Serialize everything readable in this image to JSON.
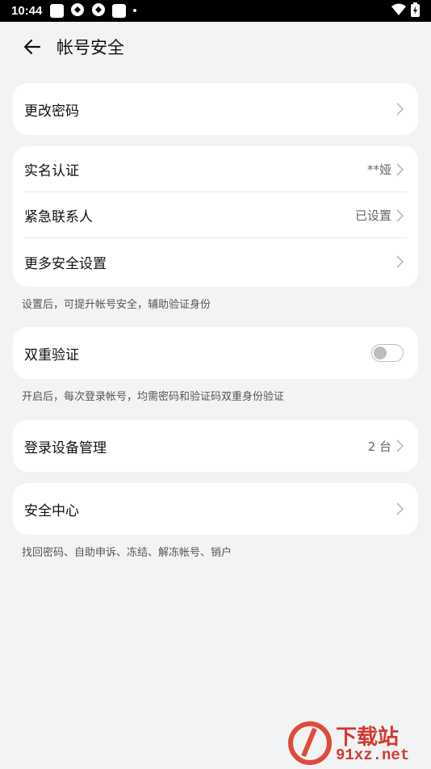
{
  "status_bar": {
    "time": "10:44",
    "dot": "•"
  },
  "header": {
    "title": "帐号安全"
  },
  "groups": {
    "password": {
      "label": "更改密码"
    },
    "identity": {
      "items": [
        {
          "label": "实名认证",
          "value": "**娅"
        },
        {
          "label": "紧急联系人",
          "value": "已设置"
        },
        {
          "label": "更多安全设置",
          "value": ""
        }
      ],
      "note": "设置后，可提升帐号安全，辅助验证身份"
    },
    "two_factor": {
      "label": "双重验证",
      "enabled": false,
      "note": "开启后，每次登录帐号，均需密码和验证码双重身份验证"
    },
    "devices": {
      "label": "登录设备管理",
      "value": "2 台"
    },
    "security_center": {
      "label": "安全中心",
      "note": "找回密码、自助申诉、冻结、解冻帐号、销户"
    }
  },
  "watermark": {
    "name": "下载站",
    "domain": "91xz.net"
  }
}
